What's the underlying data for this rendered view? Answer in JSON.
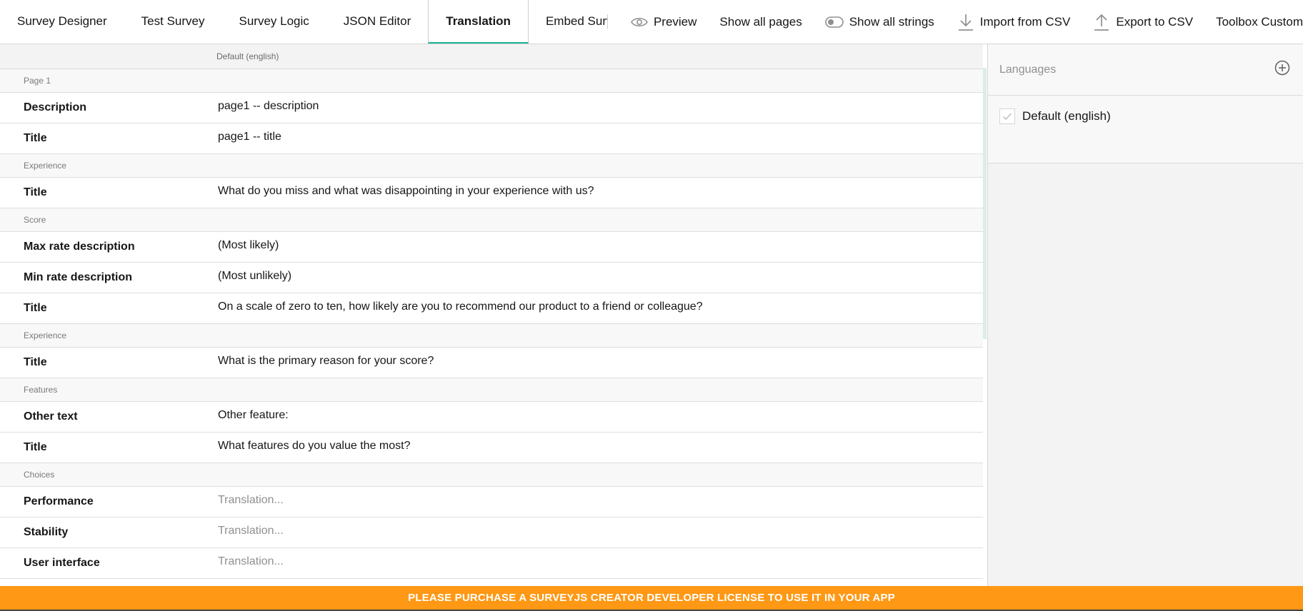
{
  "toolbar": {
    "tabs": [
      {
        "label": "Survey Designer"
      },
      {
        "label": "Test Survey"
      },
      {
        "label": "Survey Logic"
      },
      {
        "label": "JSON Editor"
      },
      {
        "label": "Translation"
      },
      {
        "label": "Embed Surv"
      }
    ],
    "active_tab": "Translation",
    "actions": {
      "preview": "Preview",
      "show_all_pages": "Show all pages",
      "show_all_strings": "Show all strings",
      "import_csv": "Import from CSV",
      "export_csv": "Export to CSV",
      "toolbox": "Toolbox Customization"
    }
  },
  "grid": {
    "column_header": "Default (english)",
    "rows": [
      {
        "type": "group",
        "label": "Page 1"
      },
      {
        "type": "item",
        "label": "Description",
        "value": "page1 -- description"
      },
      {
        "type": "item",
        "label": "Title",
        "value": "page1 -- title"
      },
      {
        "type": "group",
        "label": "Experience"
      },
      {
        "type": "item",
        "label": "Title",
        "value": "What do you miss and what was disappointing in your experience with us?"
      },
      {
        "type": "group",
        "label": "Score"
      },
      {
        "type": "item",
        "label": "Max rate description",
        "value": "(Most likely)"
      },
      {
        "type": "item",
        "label": "Min rate description",
        "value": "(Most unlikely)"
      },
      {
        "type": "item",
        "label": "Title",
        "value": "On a scale of zero to ten, how likely are you to recommend our product to a friend or colleague?"
      },
      {
        "type": "group",
        "label": "Experience"
      },
      {
        "type": "item",
        "label": "Title",
        "value": "What is the primary reason for your score?"
      },
      {
        "type": "group",
        "label": "Features"
      },
      {
        "type": "item",
        "label": "Other text",
        "value": "Other feature:"
      },
      {
        "type": "item",
        "label": "Title",
        "value": "What features do you value the most?"
      },
      {
        "type": "group",
        "label": "Choices"
      },
      {
        "type": "item",
        "label": "Performance",
        "placeholder": "Translation..."
      },
      {
        "type": "item",
        "label": "Stability",
        "placeholder": "Translation..."
      },
      {
        "type": "item",
        "label": "User interface",
        "placeholder": "Translation..."
      }
    ]
  },
  "languages": {
    "title": "Languages",
    "items": [
      {
        "label": "Default (english)",
        "checked": true
      }
    ]
  },
  "banner": {
    "text": "PLEASE PURCHASE A SURVEYJS CREATOR DEVELOPER LICENSE TO USE IT IN YOUR APP"
  },
  "colors": {
    "accent": "#19b394",
    "banner": "#ff9814"
  }
}
